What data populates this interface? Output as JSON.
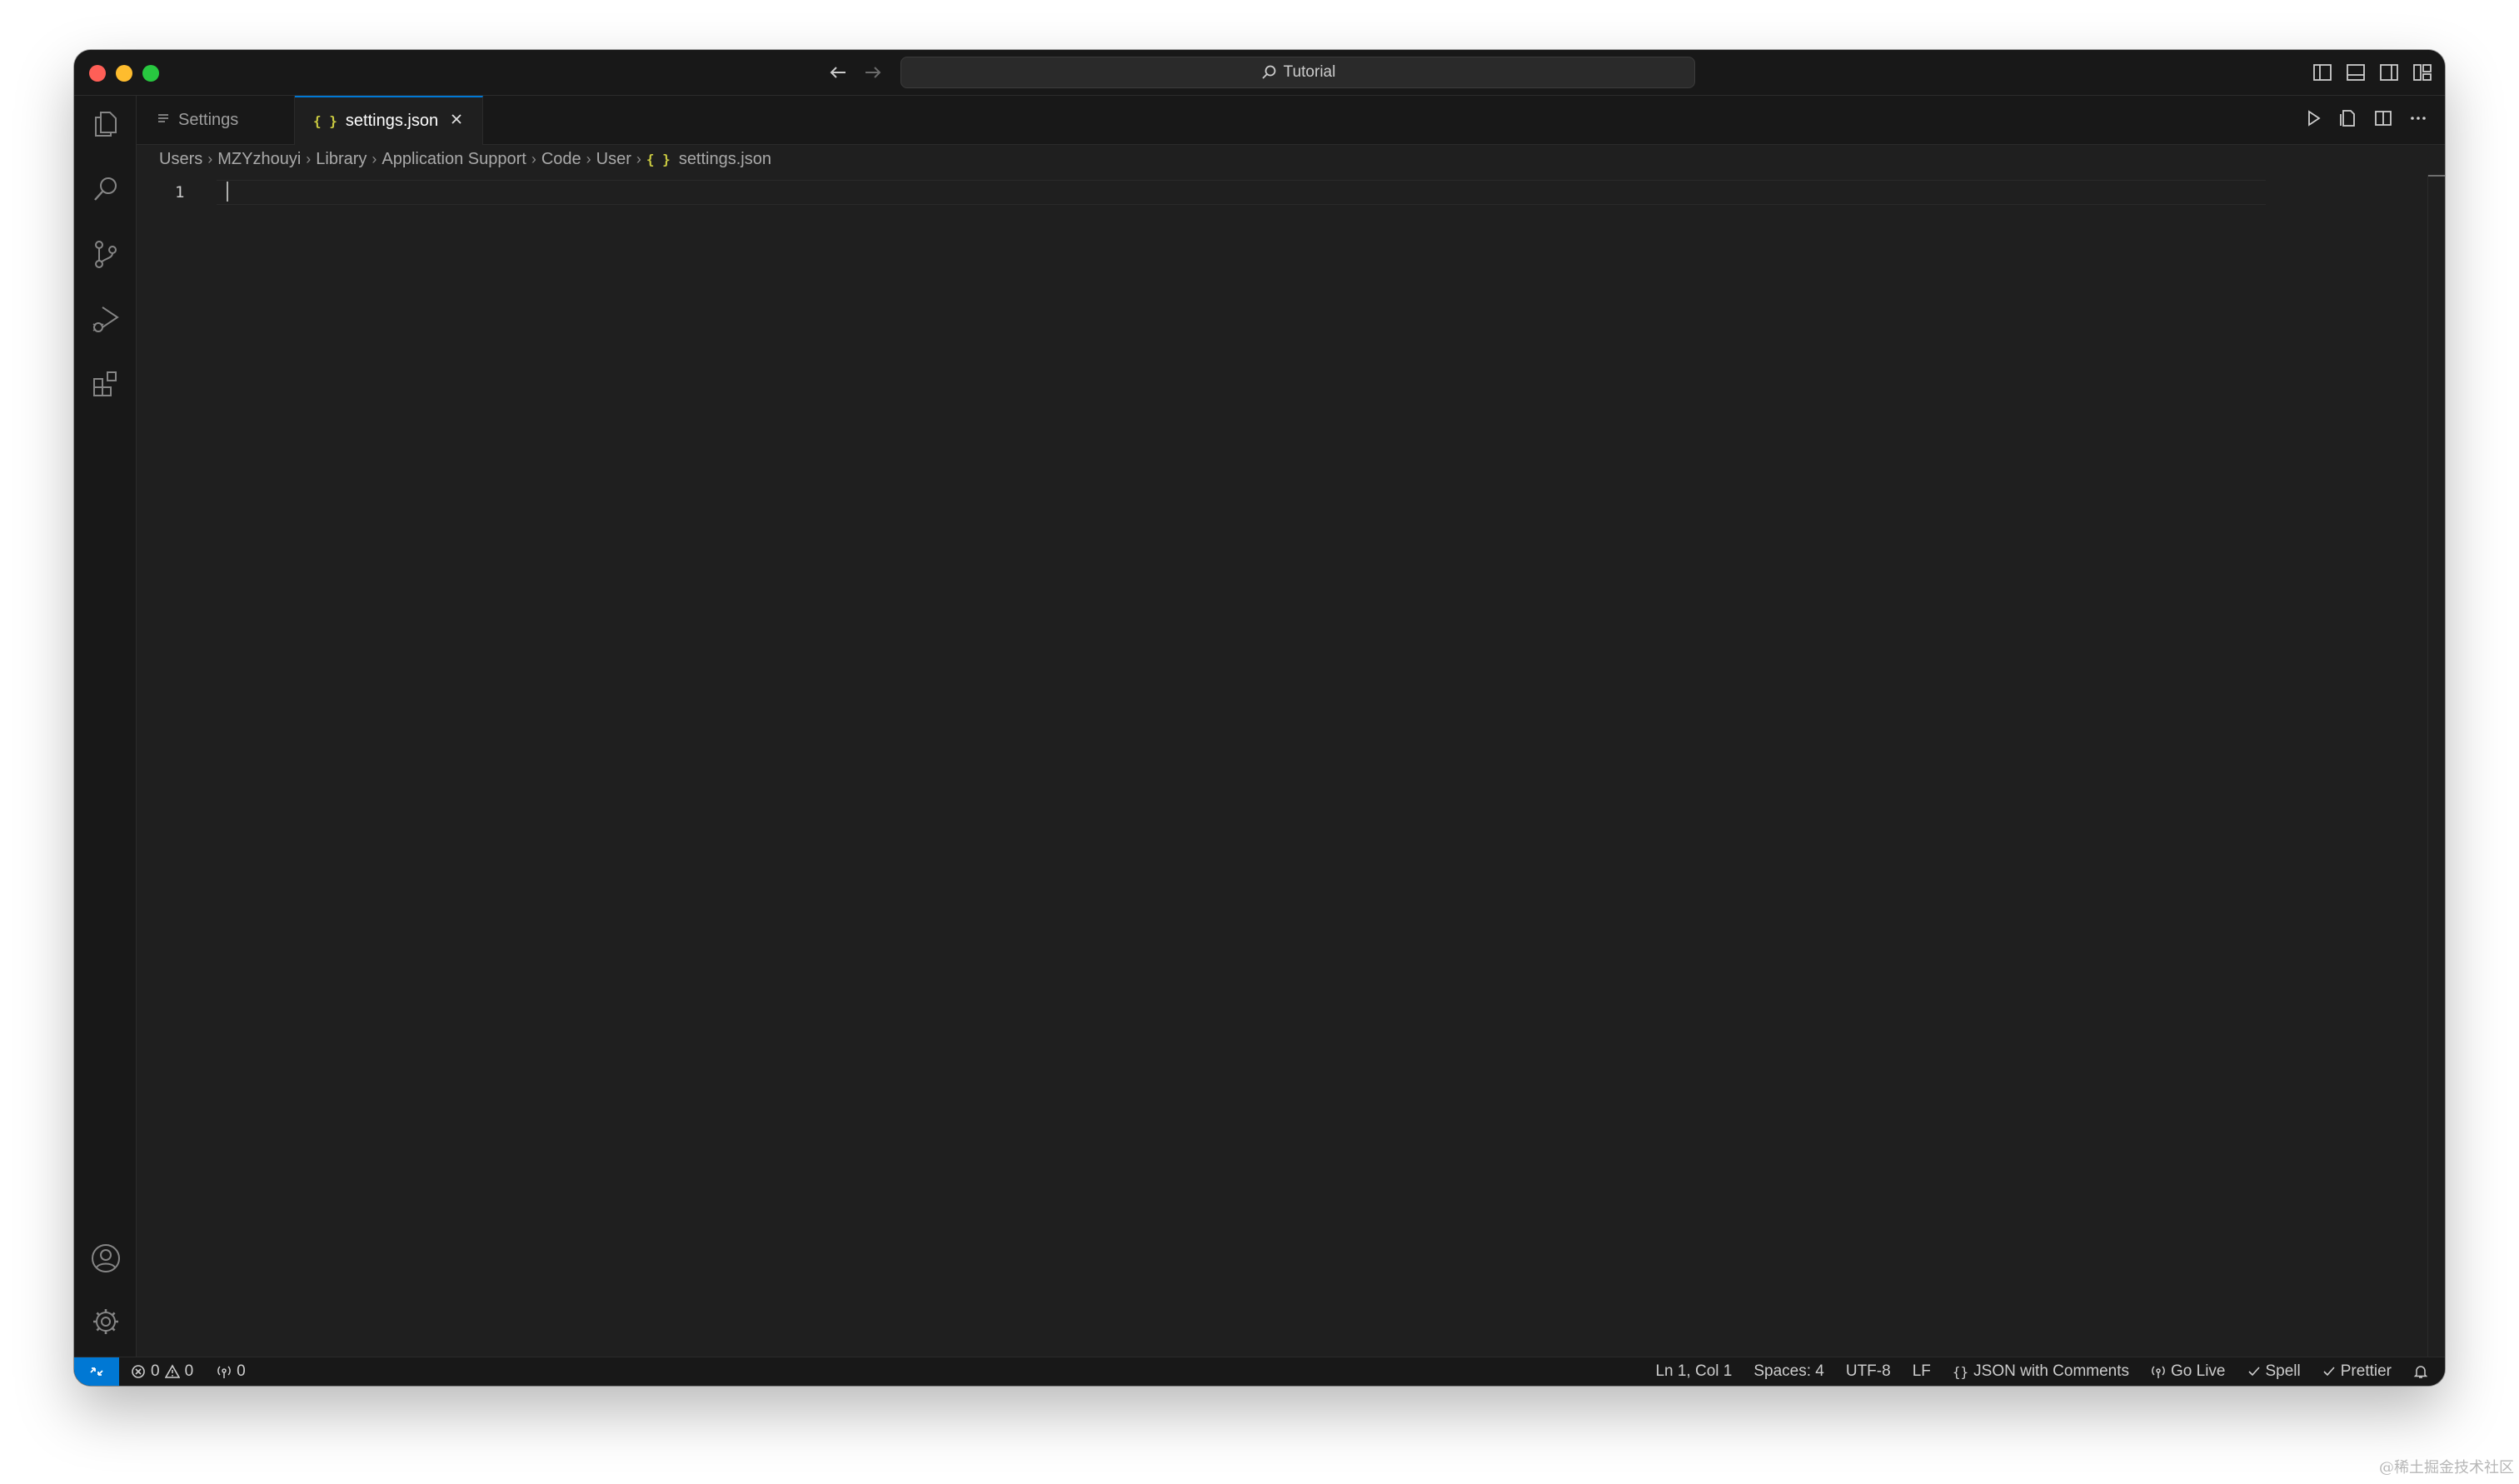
{
  "window": {
    "search_text": "Tutorial"
  },
  "tabs": [
    {
      "label": "Settings",
      "icon": "settings-list-icon",
      "active": false
    },
    {
      "label": "settings.json",
      "icon": "json-braces-icon",
      "active": true
    }
  ],
  "breadcrumb": [
    "Users",
    "MZYzhouyi",
    "Library",
    "Application Support",
    "Code",
    "User",
    "settings.json"
  ],
  "editor": {
    "line_numbers": [
      "1"
    ]
  },
  "status": {
    "errors": "0",
    "warnings": "0",
    "ports": "0",
    "position": "Ln 1, Col 1",
    "spaces": "Spaces: 4",
    "encoding": "UTF-8",
    "eol": "LF",
    "language": "JSON with Comments",
    "go_live": "Go Live",
    "spell": "Spell",
    "prettier": "Prettier"
  },
  "watermark": "@稀土掘金技术社区",
  "colors": {
    "accent": "#0078d4",
    "json_icon": "#cbcb41",
    "editor_bg": "#1f1f1f",
    "chrome_bg": "#181818"
  }
}
